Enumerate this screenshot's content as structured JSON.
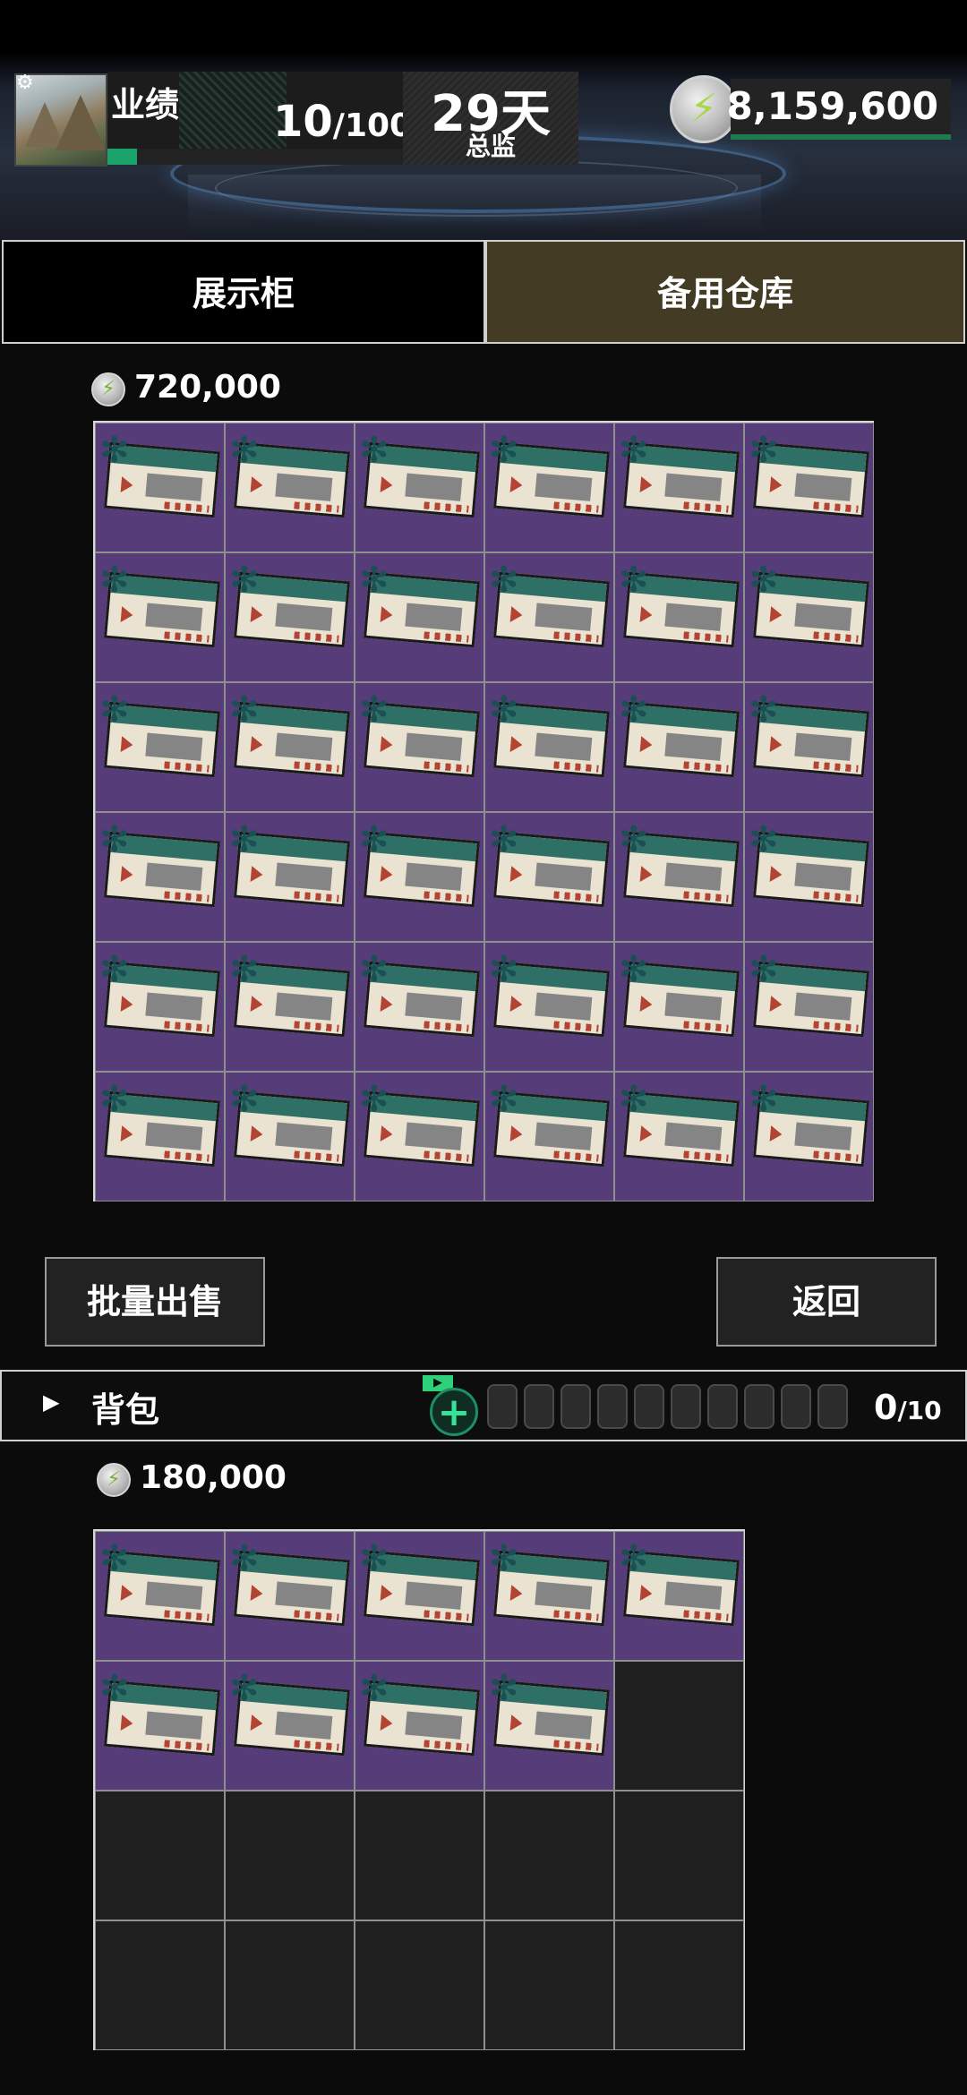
{
  "header": {
    "avatar_alt": "mountain avatar",
    "performance_label": "业绩",
    "performance_current": "10",
    "performance_total": "/100",
    "performance_progress": 0.1,
    "days": "29天",
    "role": "总监",
    "money": "8,159,600",
    "icons": {
      "settings": "gear-icon",
      "currency": "lightning-coin-icon"
    }
  },
  "tabs": {
    "showcase": "展示柜",
    "storage": "备用仓库",
    "active": "storage"
  },
  "storage": {
    "value": "720,000",
    "columns": 6,
    "rows": 6,
    "filled_count": 36,
    "item_icon": "ticket-icon"
  },
  "buttons": {
    "batch_sell": "批量出售",
    "back": "返回"
  },
  "backpack": {
    "title": "背包",
    "count_current": "0",
    "count_total": "/10",
    "slots": 10,
    "value": "180,000",
    "columns": 5,
    "rows": 4,
    "filled_count": 9,
    "item_icon": "ticket-icon",
    "add_badge_icon": "video-icon"
  },
  "colors": {
    "accent_green": "#19a36b",
    "cell_purple": "#563c78",
    "tab_active_bg": "#433b24"
  }
}
